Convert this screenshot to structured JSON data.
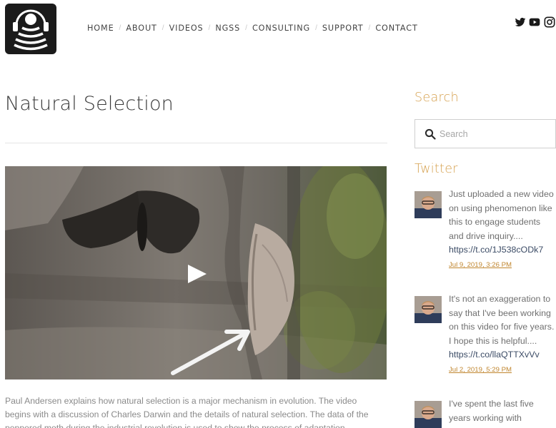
{
  "nav": {
    "items": [
      "Home",
      "About",
      "Videos",
      "NGSS",
      "Consulting",
      "Support",
      "Contact"
    ],
    "separator": "/"
  },
  "social": {
    "icons": [
      "twitter-icon",
      "youtube-icon",
      "instagram-icon"
    ]
  },
  "main": {
    "title": "Natural Selection",
    "description": "Paul Andersen explains how natural selection is a major mechanism in evolution. The video begins with a discussion of Charles Darwin and the details of natural selection. The data of the peppered moth during the industrial revolution is used to show the process of adaptation."
  },
  "sidebar": {
    "search": {
      "heading": "Search",
      "placeholder": "Search"
    },
    "twitter": {
      "heading": "Twitter",
      "tweets": [
        {
          "text": "Just uploaded a new video on using phenomenon like this to engage students and drive inquiry....",
          "link": "https://t.co/1J538cODk7",
          "date": "Jul 9, 2019, 3:26 PM"
        },
        {
          "text": "It's not an exaggeration to say that I've been working on this video for five years. I hope this is helpful....",
          "link": "https://t.co/llaQTTXvVv",
          "date": "Jul 2, 2019, 5:29 PM"
        },
        {
          "text": "I've spent the last five years working with",
          "link": "",
          "date": ""
        }
      ]
    }
  },
  "colors": {
    "accent": "#d6a14f",
    "link": "#3c4c66",
    "date": "#c0862f",
    "text": "#8a8a8a"
  }
}
